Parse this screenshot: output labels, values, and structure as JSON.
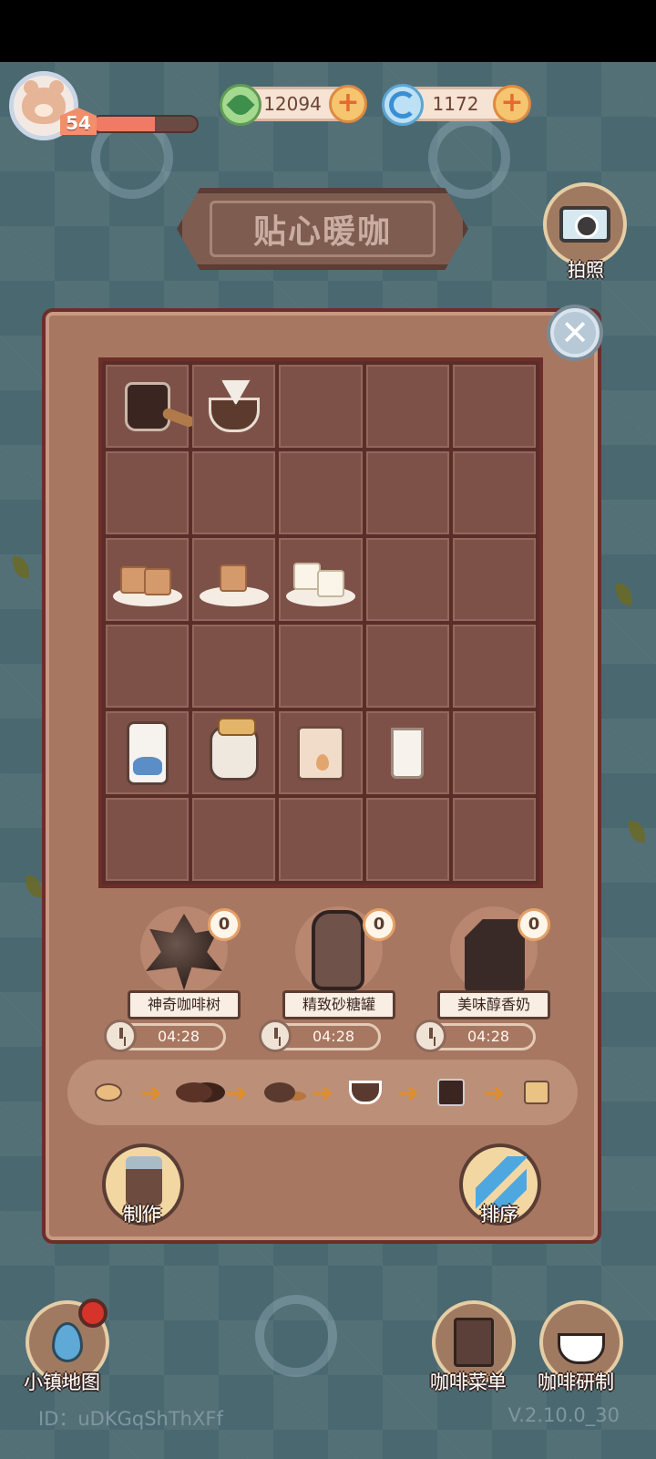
{
  "player": {
    "level": "54",
    "xp_fraction": 0.6
  },
  "currency": {
    "mint": {
      "value": "12094",
      "icon": "mint-leaf-icon"
    },
    "swirl": {
      "value": "1172",
      "icon": "blue-swirl-icon"
    }
  },
  "title": "贴心暖咖",
  "camera": {
    "label": "拍照"
  },
  "inventory": {
    "columns": 5,
    "rows": 6,
    "items": [
      {
        "row": 0,
        "col": 0,
        "item": "coffee-jug"
      },
      {
        "row": 0,
        "col": 1,
        "item": "coffee-cup-with-filter"
      },
      {
        "row": 2,
        "col": 0,
        "item": "brown-sugar-cubes-large"
      },
      {
        "row": 2,
        "col": 1,
        "item": "brown-sugar-cube"
      },
      {
        "row": 2,
        "col": 2,
        "item": "white-sugar-cubes"
      },
      {
        "row": 4,
        "col": 0,
        "item": "milk-bottle"
      },
      {
        "row": 4,
        "col": 1,
        "item": "milk-jar"
      },
      {
        "row": 4,
        "col": 2,
        "item": "milk-powder-bag"
      },
      {
        "row": 4,
        "col": 3,
        "item": "glass-of-milk"
      }
    ]
  },
  "producers": [
    {
      "name": "神奇咖啡树",
      "count": "0",
      "timer": "04:28"
    },
    {
      "name": "精致砂糖罐",
      "count": "0",
      "timer": "04:28"
    },
    {
      "name": "美味醇香奶",
      "count": "0",
      "timer": "04:28"
    }
  ],
  "chain": [
    "coffee-bean",
    "roasted-beans",
    "coffee-scoop",
    "filter-cup",
    "coffee-jug",
    "espresso-shots"
  ],
  "actions": {
    "make": "制作",
    "sort": "排序"
  },
  "nav": {
    "map": "小镇地图",
    "menu": "咖啡菜单",
    "research": "咖啡研制"
  },
  "footer": {
    "id": "ID：uDKGqShThXFf",
    "version": "V.2.10.0_30"
  },
  "colors": {
    "panel": "#a87761",
    "grid": "#5a2e28",
    "accent": "#e08e2a"
  }
}
